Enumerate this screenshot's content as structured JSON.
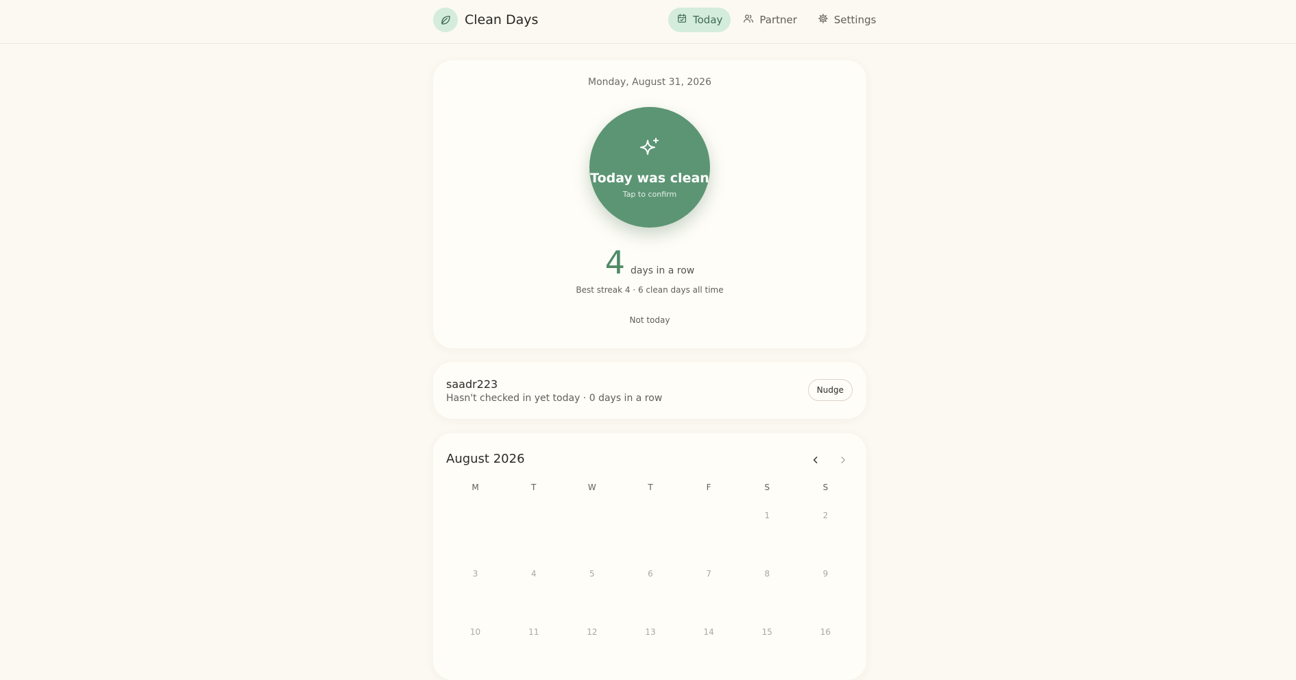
{
  "app": {
    "title": "Clean Days"
  },
  "nav": [
    {
      "label": "Today",
      "icon": "calendar-check-icon",
      "active": true
    },
    {
      "label": "Partner",
      "icon": "users-icon",
      "active": false
    },
    {
      "label": "Settings",
      "icon": "gear-icon",
      "active": false
    }
  ],
  "today": {
    "date": "Monday, August 31, 2026",
    "button_title": "Today was clean",
    "button_sub": "Tap to confirm",
    "streak_count": "4",
    "streak_label": "days in a row",
    "streak_meta": "Best streak 4 · 6 clean days all time",
    "not_today": "Not today"
  },
  "partner": {
    "name": "saadr223",
    "status": "Hasn't checked in yet today · 0 days in a row",
    "nudge_label": "Nudge"
  },
  "calendar": {
    "month": "August 2026",
    "weekdays": [
      "M",
      "T",
      "W",
      "T",
      "F",
      "S",
      "S"
    ],
    "days": [
      "",
      "",
      "",
      "",
      "",
      "1",
      "2",
      "3",
      "4",
      "5",
      "6",
      "7",
      "8",
      "9",
      "10",
      "11",
      "12",
      "13",
      "14",
      "15",
      "16"
    ]
  },
  "colors": {
    "accent": "#5c9574",
    "accent_soft": "#d4ecdc",
    "background": "#fcf9f2",
    "card": "#fffdf8"
  }
}
